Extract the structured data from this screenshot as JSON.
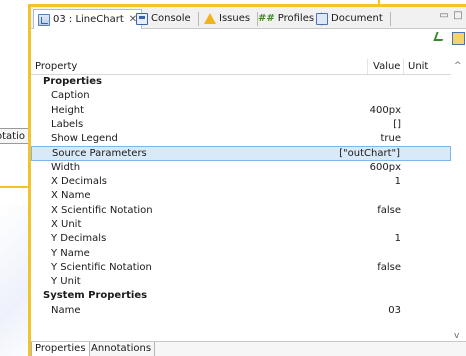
{
  "background": {
    "left_tab_label": "otatio"
  },
  "tabs": [
    {
      "label": "03 : LineChart",
      "icon": "chart-icon",
      "closable": true,
      "active": true
    },
    {
      "label": "Console",
      "icon": "console-icon",
      "active": false
    },
    {
      "label": "Issues",
      "icon": "warning-icon",
      "active": false
    },
    {
      "label": "Profiles",
      "icon": "hash-icon",
      "icon_text": "##",
      "active": false
    },
    {
      "label": "Document",
      "icon": "document-icon",
      "active": false
    }
  ],
  "window_buttons": {
    "minimize": "▭",
    "maximize": "□"
  },
  "table": {
    "headers": {
      "property": "Property",
      "value": "Value",
      "unit": "Unit"
    },
    "rows": [
      {
        "type": "category",
        "name": "Properties",
        "value": ""
      },
      {
        "type": "item",
        "name": "Caption",
        "value": ""
      },
      {
        "type": "item",
        "name": "Height",
        "value": "400px"
      },
      {
        "type": "item",
        "name": "Labels",
        "value": "[]"
      },
      {
        "type": "item",
        "name": "Show Legend",
        "value": "true"
      },
      {
        "type": "item",
        "name": "Source Parameters",
        "value": "[\"outChart\"]",
        "selected": true
      },
      {
        "type": "item",
        "name": "Width",
        "value": "600px"
      },
      {
        "type": "item",
        "name": "X Decimals",
        "value": "1"
      },
      {
        "type": "item",
        "name": "X Name",
        "value": ""
      },
      {
        "type": "item",
        "name": "X Scientific Notation",
        "value": "false"
      },
      {
        "type": "item",
        "name": "X Unit",
        "value": ""
      },
      {
        "type": "item",
        "name": "Y Decimals",
        "value": "1"
      },
      {
        "type": "item",
        "name": "Y Name",
        "value": ""
      },
      {
        "type": "item",
        "name": "Y Scientific Notation",
        "value": "false"
      },
      {
        "type": "item",
        "name": "Y Unit",
        "value": ""
      },
      {
        "type": "category",
        "name": "System Properties",
        "value": ""
      },
      {
        "type": "item",
        "name": "Name",
        "value": "03"
      }
    ]
  },
  "bottom_tabs": [
    {
      "label": "Properties",
      "active": true
    },
    {
      "label": "Annotations",
      "active": false
    }
  ],
  "colors": {
    "highlight_border": "#f1c32c",
    "selection_bg": "#d8eaf9",
    "selection_border": "#7fb6e3"
  }
}
